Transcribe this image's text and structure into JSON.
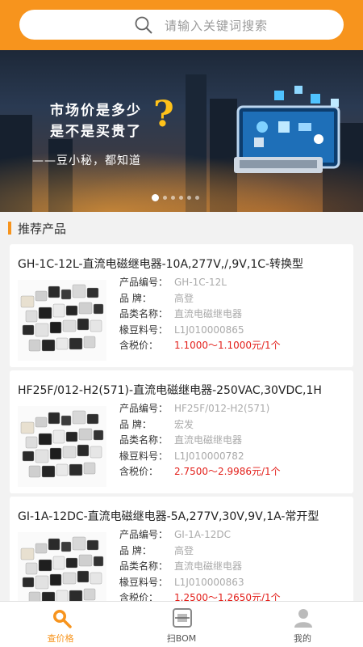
{
  "search": {
    "placeholder": "请输入关键词搜索"
  },
  "banner": {
    "line1": "市场价是多少",
    "line2": "是不是买贵了",
    "qmark": "?",
    "line3": "——豆小秘，都知道",
    "slide_count": 6,
    "active_slide": 1
  },
  "section": {
    "title": "推荐产品"
  },
  "labels": {
    "product_no": "产品编号：",
    "brand": "品       牌：",
    "category": "品类名称：",
    "ldb_no": "椽豆料号：",
    "price": "含税价："
  },
  "products": [
    {
      "title": "GH-1C-12L-直流电磁继电器-10A,277V,/,9V,1C-转换型",
      "product_no": "GH-1C-12L",
      "brand": "高登",
      "category": "直流电磁继电器",
      "ldb_no": "L1J010000865",
      "price": "1.1000～1.1000元/1个"
    },
    {
      "title": "HF25F/012-H2(571)-直流电磁继电器-250VAC,30VDC,1H",
      "product_no": "HF25F/012-H2(571)",
      "brand": "宏发",
      "category": "直流电磁继电器",
      "ldb_no": "L1J010000782",
      "price": "2.7500～2.9986元/1个"
    },
    {
      "title": "GI-1A-12DC-直流电磁继电器-5A,277V,30V,9V,1A-常开型",
      "product_no": "GI-1A-12DC",
      "brand": "高登",
      "category": "直流电磁继电器",
      "ldb_no": "L1J010000863",
      "price": "1.2500～1.2650元/1个"
    }
  ],
  "nav": [
    {
      "label": "查价格",
      "icon": "search-price-icon",
      "active": true
    },
    {
      "label": "扫BOM",
      "icon": "scan-icon",
      "active": false
    },
    {
      "label": "我的",
      "icon": "user-icon",
      "active": false
    }
  ],
  "colors": {
    "accent": "#f7941d",
    "price": "#e3201b"
  }
}
